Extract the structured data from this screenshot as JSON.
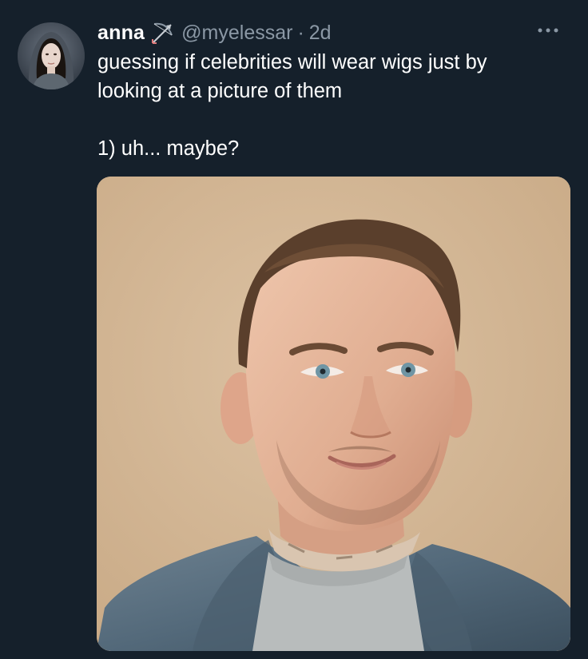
{
  "tweet": {
    "author": {
      "name": "anna",
      "emoji": "bow-and-arrow-icon",
      "handle": "@myelessar",
      "separator": "·",
      "time": "2d"
    },
    "text": {
      "line1": "guessing if celebrities will wear wigs just by",
      "line2": "looking at a picture of them",
      "line3": "1) uh... maybe?"
    },
    "more_icon": "more-icon"
  },
  "colors": {
    "background": "#15202b",
    "text_primary": "#ffffff",
    "text_secondary": "#8b98a5"
  }
}
